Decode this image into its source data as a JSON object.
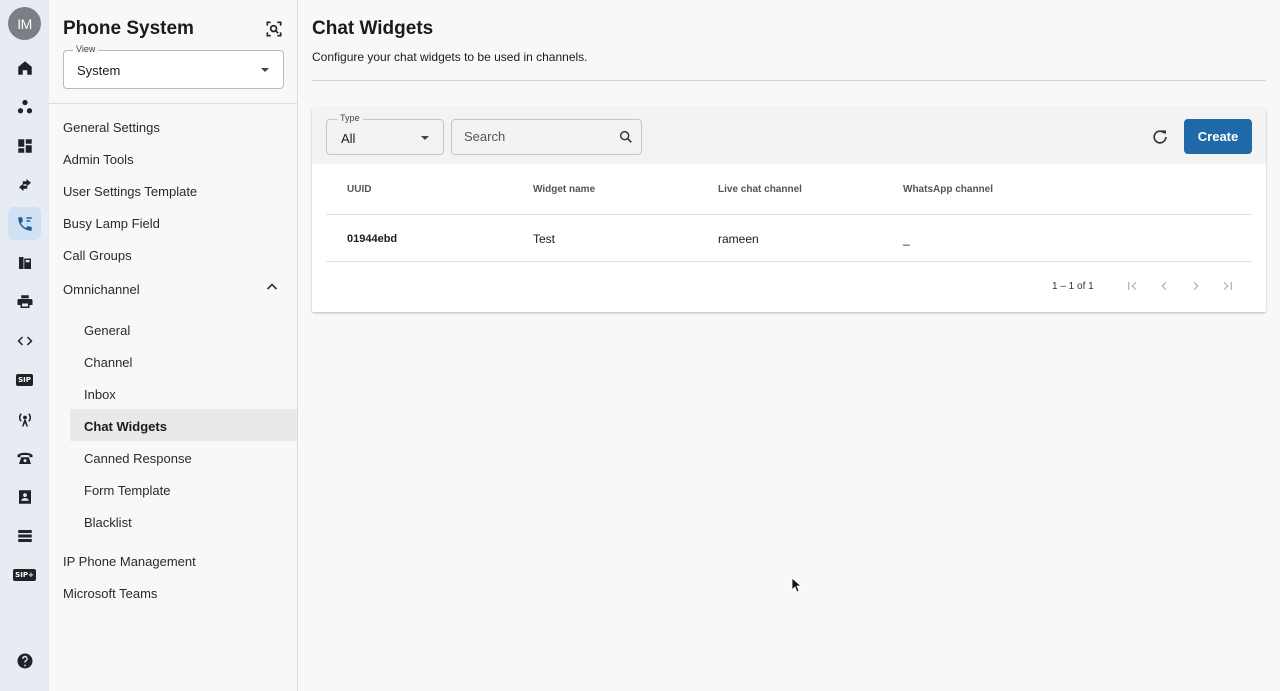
{
  "user": {
    "initials": "IM"
  },
  "rail": {
    "icons": [
      "home-icon",
      "nodes-icon",
      "dashboard-icon",
      "transfer-arrows-icon",
      "phone-icon",
      "fax-icon",
      "printer-icon",
      "code-icon",
      "sip-icon",
      "antenna-icon",
      "desk-phone-icon",
      "contacts-icon",
      "server-icon",
      "sip-plus-icon",
      "help-icon"
    ],
    "sip_label": "SIP",
    "sip_plus_label": "SIP+"
  },
  "subnav": {
    "title": "Phone System",
    "view": {
      "label": "View",
      "value": "System"
    },
    "items": [
      {
        "label": "General Settings"
      },
      {
        "label": "Admin Tools"
      },
      {
        "label": "User Settings Template"
      },
      {
        "label": "Busy Lamp Field"
      },
      {
        "label": "Call Groups"
      },
      {
        "label": "Omnichannel",
        "expanded": true
      }
    ],
    "omnichannel_children": [
      {
        "label": "General"
      },
      {
        "label": "Channel"
      },
      {
        "label": "Inbox"
      },
      {
        "label": "Chat Widgets",
        "active": true
      },
      {
        "label": "Canned Response"
      },
      {
        "label": "Form Template"
      },
      {
        "label": "Blacklist"
      }
    ],
    "items_after": [
      {
        "label": "IP Phone Management"
      },
      {
        "label": "Microsoft Teams"
      }
    ]
  },
  "main": {
    "title": "Chat Widgets",
    "subtitle": "Configure your chat widgets to be used in channels.",
    "filters": {
      "type": {
        "label": "Type",
        "value": "All"
      },
      "search": {
        "placeholder": "Search"
      }
    },
    "create_label": "Create",
    "table": {
      "columns": [
        "UUID",
        "Widget name",
        "Live chat channel",
        "WhatsApp channel"
      ],
      "rows": [
        {
          "uuid": "01944ebd",
          "widget_name": "Test",
          "live_chat_channel": "rameen",
          "whatsapp_channel": "_"
        }
      ]
    },
    "pagination": {
      "text": "1 – 1 of 1"
    }
  },
  "colors": {
    "accent": "#1f69a8",
    "rail_bg": "#e6ecf2",
    "active_rail": "#cfe1f3"
  }
}
